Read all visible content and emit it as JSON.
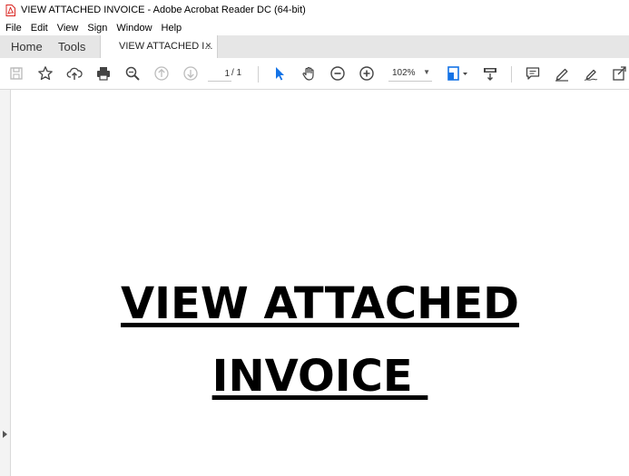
{
  "window": {
    "title": "VIEW ATTACHED INVOICE - Adobe Acrobat Reader DC (64-bit)",
    "icon": "acrobat-pdf-icon",
    "accent": "#d9231f"
  },
  "menubar": {
    "items": [
      "File",
      "Edit",
      "View",
      "Sign",
      "Window",
      "Help"
    ]
  },
  "tabs": {
    "home": "Home",
    "tools": "Tools",
    "document": "VIEW ATTACHED I...",
    "close": "×"
  },
  "toolbar": {
    "icons": [
      "save-icon",
      "bookmark-star-icon",
      "upload-cloud-icon",
      "print-icon",
      "zoom-search-icon",
      "page-up-icon",
      "page-down-icon",
      "select-pointer-icon",
      "hand-pan-icon",
      "zoom-out-icon",
      "zoom-in-icon",
      "fit-page-icon",
      "scroll-mode-icon",
      "comment-icon",
      "highlight-pen-icon",
      "sign-pen-icon",
      "share-icon"
    ],
    "page_current": "1",
    "page_total": "/ 1",
    "zoom": "102%",
    "active_color": "#1473e6"
  },
  "document": {
    "line1": "VIEW ATTACHED",
    "line2": "INVOICE "
  }
}
